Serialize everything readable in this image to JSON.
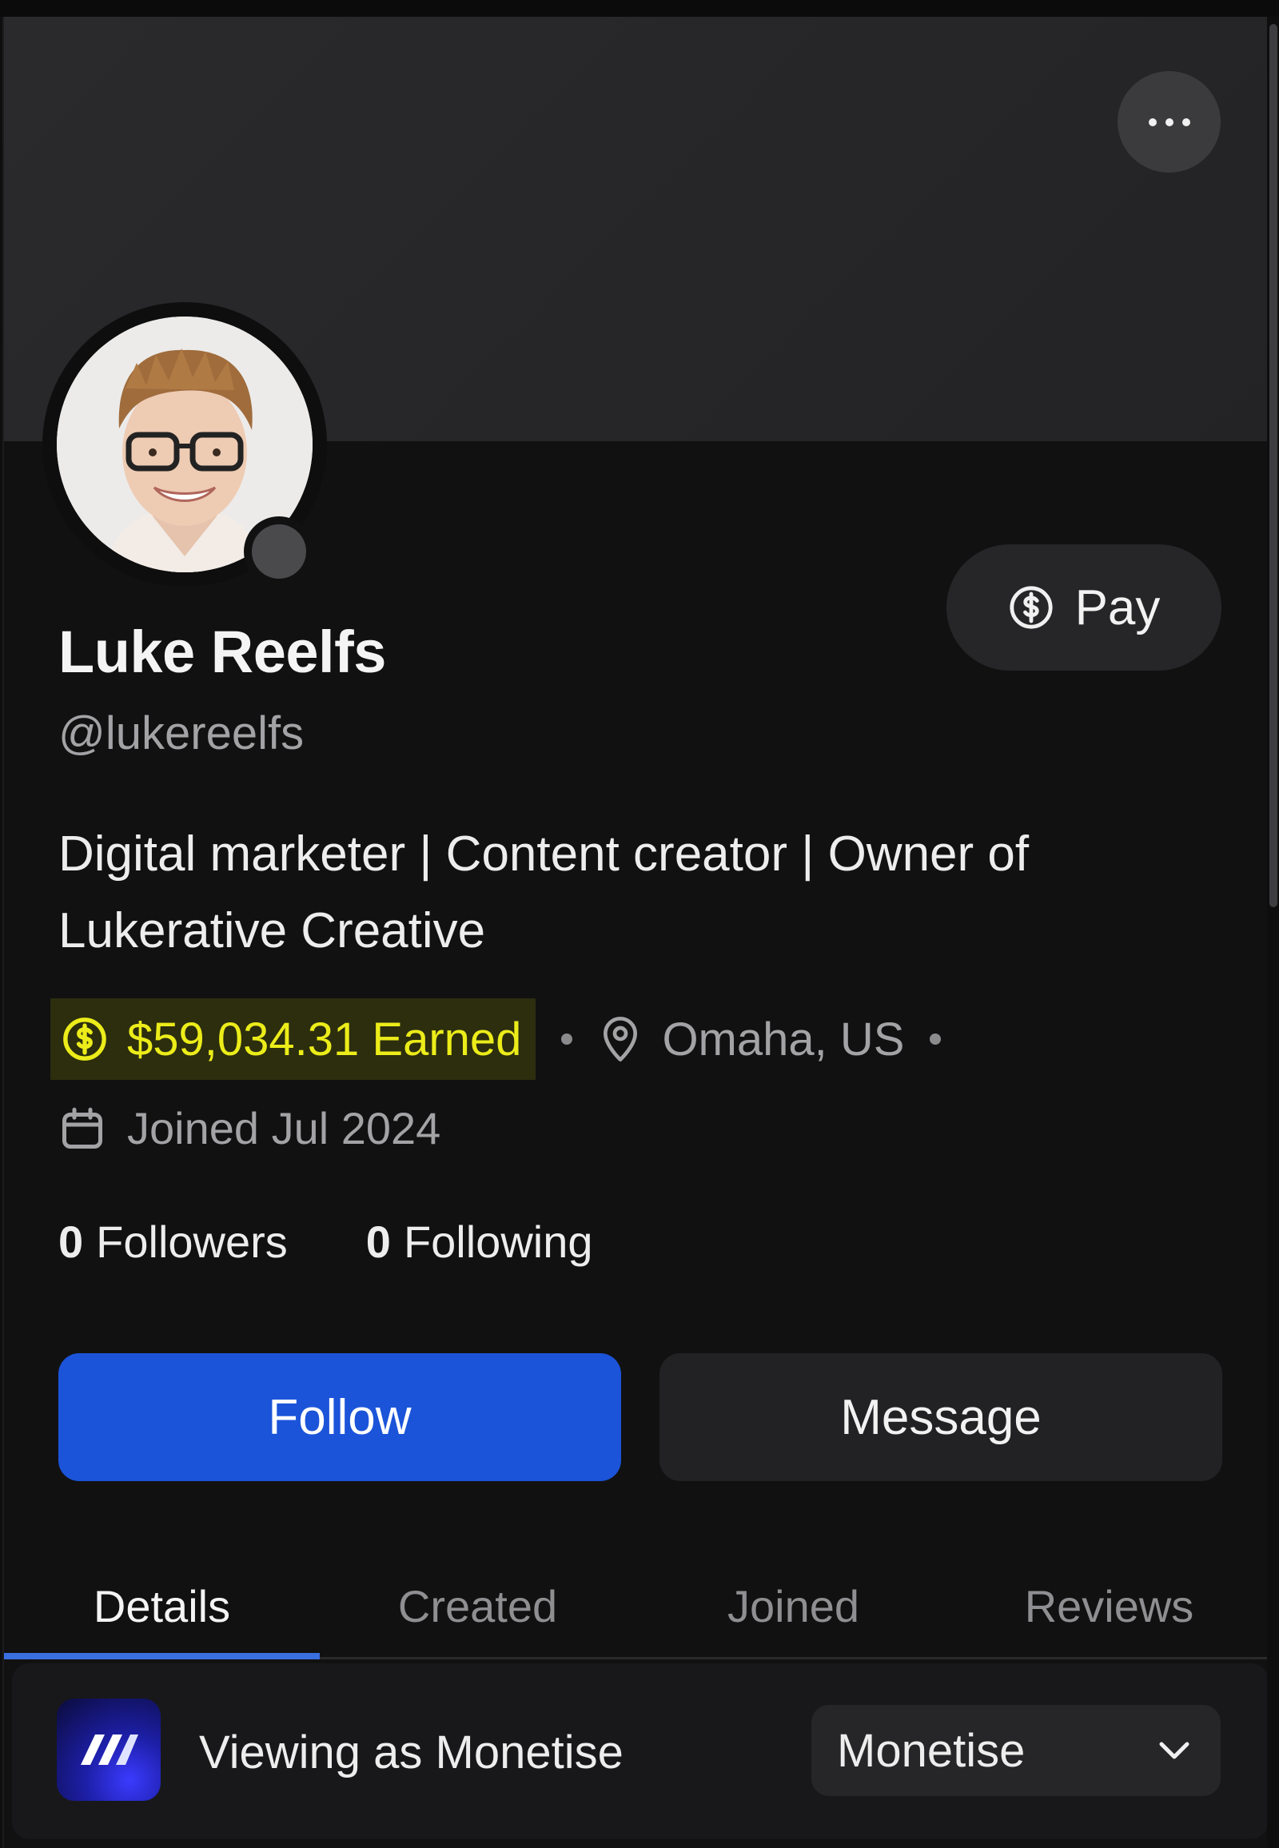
{
  "profile": {
    "name": "Luke Reelfs",
    "handle": "@lukereelfs",
    "bio": "Digital marketer | Content creator | Owner of Lukerative Creative",
    "earned": "$59,034.31 Earned",
    "location": "Omaha, US",
    "joined": "Joined Jul 2024",
    "followers_count": "0",
    "followers_label": "Followers",
    "following_count": "0",
    "following_label": "Following"
  },
  "actions": {
    "pay_label": "Pay",
    "follow_label": "Follow",
    "message_label": "Message"
  },
  "tabs": [
    {
      "label": "Details",
      "active": true
    },
    {
      "label": "Created",
      "active": false
    },
    {
      "label": "Joined",
      "active": false
    },
    {
      "label": "Reviews",
      "active": false
    }
  ],
  "viewing": {
    "text": "Viewing as Monetise",
    "selected": "Monetise"
  },
  "icons": {
    "more": "more-horizontal-icon",
    "pay": "dollar-circle-icon",
    "earned": "dollar-circle-icon",
    "location": "map-pin-icon",
    "joined": "calendar-icon",
    "select": "chevron-down-icon"
  },
  "colors": {
    "accent_blue": "#1b54d9",
    "earned_yellow": "#ecec1a",
    "earned_bg": "#2c2e0e",
    "background": "#111112"
  }
}
